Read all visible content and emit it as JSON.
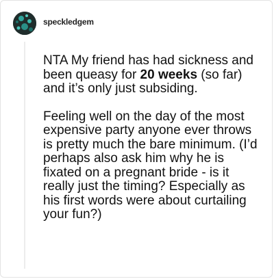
{
  "post": {
    "username": "speckledgem",
    "avatar_icon": "avatar-icon",
    "paragraph1": {
      "before": "NTA My friend has had sickness and been queasy for ",
      "bold": "20 weeks",
      "after": " (so far) and it’s only just subsiding."
    },
    "paragraph2": "Feeling well on the day of the most expensive party anyone ever throws is pretty much the bare minimum. (I’d perhaps also ask him why he is fixated on a pregnant bride - is it really just the timing? Especially as his first words were about curtailing your fun?)"
  },
  "colors": {
    "avatar_bg": "#1f2d2c",
    "avatar_accent": "#2fa39a",
    "text": "#111111"
  }
}
